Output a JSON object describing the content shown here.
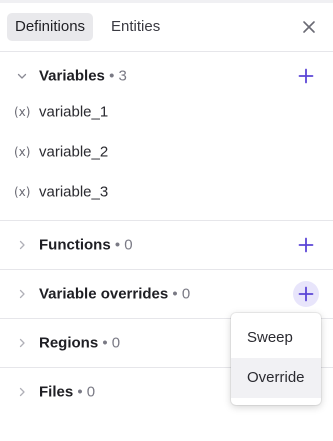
{
  "accent_color": "#5b45d6",
  "header": {
    "tabs": [
      {
        "label": "Definitions",
        "active": true
      },
      {
        "label": "Entities",
        "active": false
      }
    ],
    "close_icon": "close-icon"
  },
  "sections": {
    "variables": {
      "title": "Variables",
      "separator": "•",
      "count": "3",
      "expanded": true,
      "items": [
        {
          "icon": "(x)",
          "name": "variable_1"
        },
        {
          "icon": "(x)",
          "name": "variable_2"
        },
        {
          "icon": "(x)",
          "name": "variable_3"
        }
      ]
    },
    "functions": {
      "title": "Functions",
      "separator": "•",
      "count": "0"
    },
    "variable_overrides": {
      "title": "Variable overrides",
      "separator": "•",
      "count": "0"
    },
    "regions": {
      "title": "Regions",
      "separator": "•",
      "count": "0"
    },
    "files": {
      "title": "Files",
      "separator": "•",
      "count": "0"
    }
  },
  "dropdown": {
    "items": [
      "Sweep",
      "Override"
    ]
  }
}
